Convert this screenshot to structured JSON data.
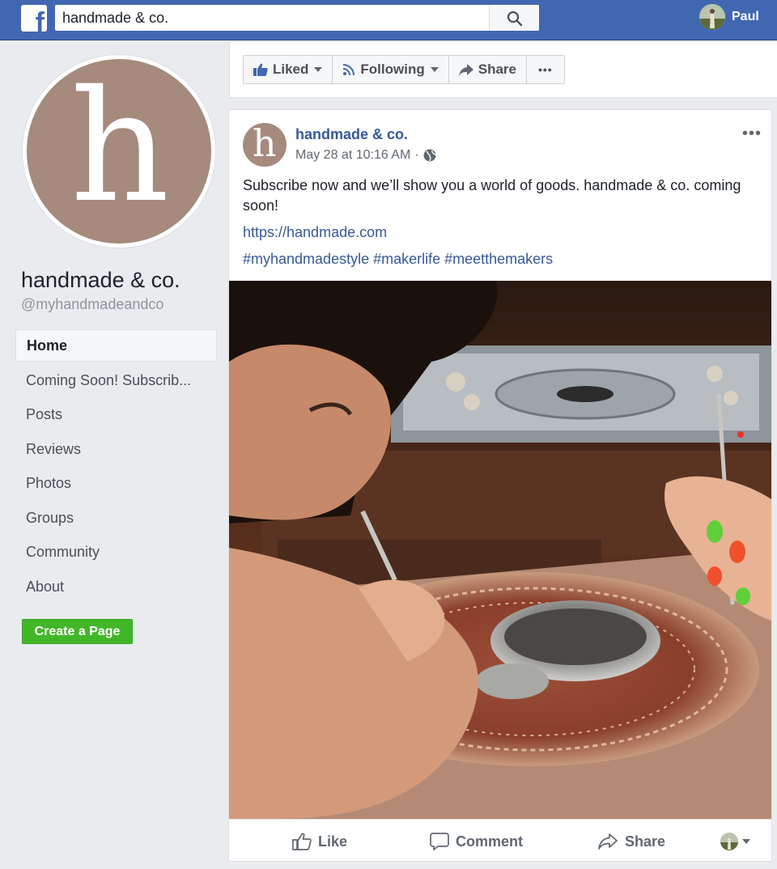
{
  "topbar": {
    "logo": "f",
    "search_value": "handmade & co.",
    "user_name": "Paul"
  },
  "page": {
    "logo_letter": "h",
    "name": "handmade & co.",
    "handle": "@myhandmadeandco"
  },
  "nav": {
    "items": [
      "Home",
      "Coming Soon! Subscrib...",
      "Posts",
      "Reviews",
      "Photos",
      "Groups",
      "Community",
      "About"
    ],
    "active": "Home"
  },
  "create_page_label": "Create a Page",
  "action_bar": {
    "liked": "Liked",
    "following": "Following",
    "share": "Share",
    "more": "•••"
  },
  "post": {
    "author": "handmade & co.",
    "timestamp": "May 28 at 10:16 AM",
    "separator": "·",
    "menu": "•••",
    "text": "Subscribe now and we’ll show you a world of goods. handmade & co. coming soon!",
    "link": "https://handmade.com",
    "hashtags": "#myhandmadestyle #makerlife #meetthemakers"
  },
  "post_footer": {
    "like": "Like",
    "comment": "Comment",
    "share": "Share"
  },
  "colors": {
    "brand_blue": "#4267b2",
    "link_blue": "#385898",
    "green": "#42b72a",
    "logo_brown": "#a58a7d"
  },
  "icons": [
    "search-icon",
    "thumbs-up-icon",
    "rss-icon",
    "share-arrow-icon",
    "globe-icon",
    "comment-icon",
    "chevron-down-icon"
  ]
}
